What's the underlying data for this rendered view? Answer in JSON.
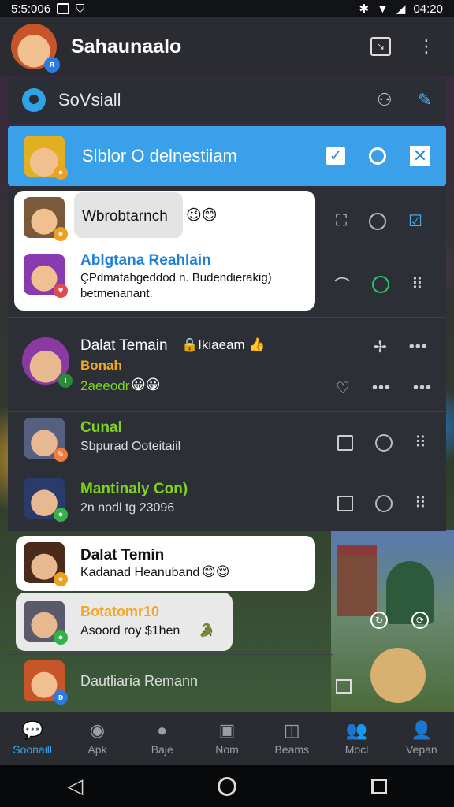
{
  "status": {
    "time_left": "5:5:006",
    "time_right": "04:20"
  },
  "app": {
    "title": "Sahaunaalo",
    "header_badge": "ᴙ"
  },
  "search": {
    "text": "SoVsiall"
  },
  "highlight": {
    "text": "Slblor O delnestiiam"
  },
  "popup": {
    "bubble_text": "Wbrobtarnch",
    "bubble_emoji": "😉😊",
    "name": "Ablgtana Reahlain",
    "line1": "ÇPdmatahgeddod n. Budendierakig)",
    "line2": "betmenanant."
  },
  "contacts": [
    {
      "name": "Dalat Temain",
      "extra": "🔒Ikiaeam 👍",
      "sub1": "Bonah",
      "sub2": "2aeeodr",
      "emoji": "😀😀"
    },
    {
      "name": "Cunal",
      "sub": "Sbpurad Ooteitaiil"
    },
    {
      "name": "Mantinaly Con)",
      "sub": "2n nodl tg 23096"
    }
  ],
  "card_b": {
    "name": "Dalat Temin",
    "sub": "Kadanad Heanuband",
    "emoji": "😊😌"
  },
  "card_c": {
    "name": "Botatomr10",
    "sub": "Asoord roy $1hen",
    "emoji": "🐊"
  },
  "last_row": {
    "name": "Dautliaria Remann"
  },
  "nav": [
    {
      "label": "Soonaill",
      "icon": "chat-icon",
      "active": true
    },
    {
      "label": "Apk",
      "icon": "group-icon"
    },
    {
      "label": "Baje",
      "icon": "bubble-icon"
    },
    {
      "label": "Nom",
      "icon": "camera-icon"
    },
    {
      "label": "Beams",
      "icon": "mask-icon"
    },
    {
      "label": "Mocl",
      "icon": "people-icon"
    },
    {
      "label": "Vepan",
      "icon": "person-icon"
    }
  ],
  "colors": {
    "accent": "#3aa0ea",
    "green": "#7ed321",
    "orange": "#f5a623",
    "blue_name": "#1e7fd6"
  }
}
